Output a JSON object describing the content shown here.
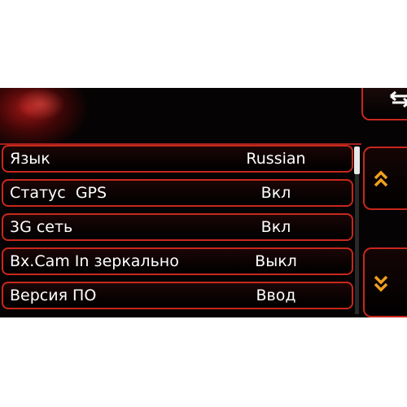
{
  "header": {
    "back_icon": "return-arrow-icon"
  },
  "menu": {
    "items": [
      {
        "label": "Язык",
        "value": "Russian"
      },
      {
        "label": "Статус  GPS",
        "value": "Вкл"
      },
      {
        "label": "3G сеть",
        "value": "Вкл"
      },
      {
        "label": "Вх.Cam In зеркально",
        "value": "Выкл"
      },
      {
        "label": "Версия ПО",
        "value": "Ввод"
      }
    ]
  },
  "controls": {
    "scroll_up_icon": "double-chevron-up-icon",
    "scroll_down_icon": "double-chevron-down-icon"
  },
  "colors": {
    "accent": "#c8281c",
    "chevron": "#f0a020",
    "background": "#050303",
    "text": "#ffffff"
  }
}
